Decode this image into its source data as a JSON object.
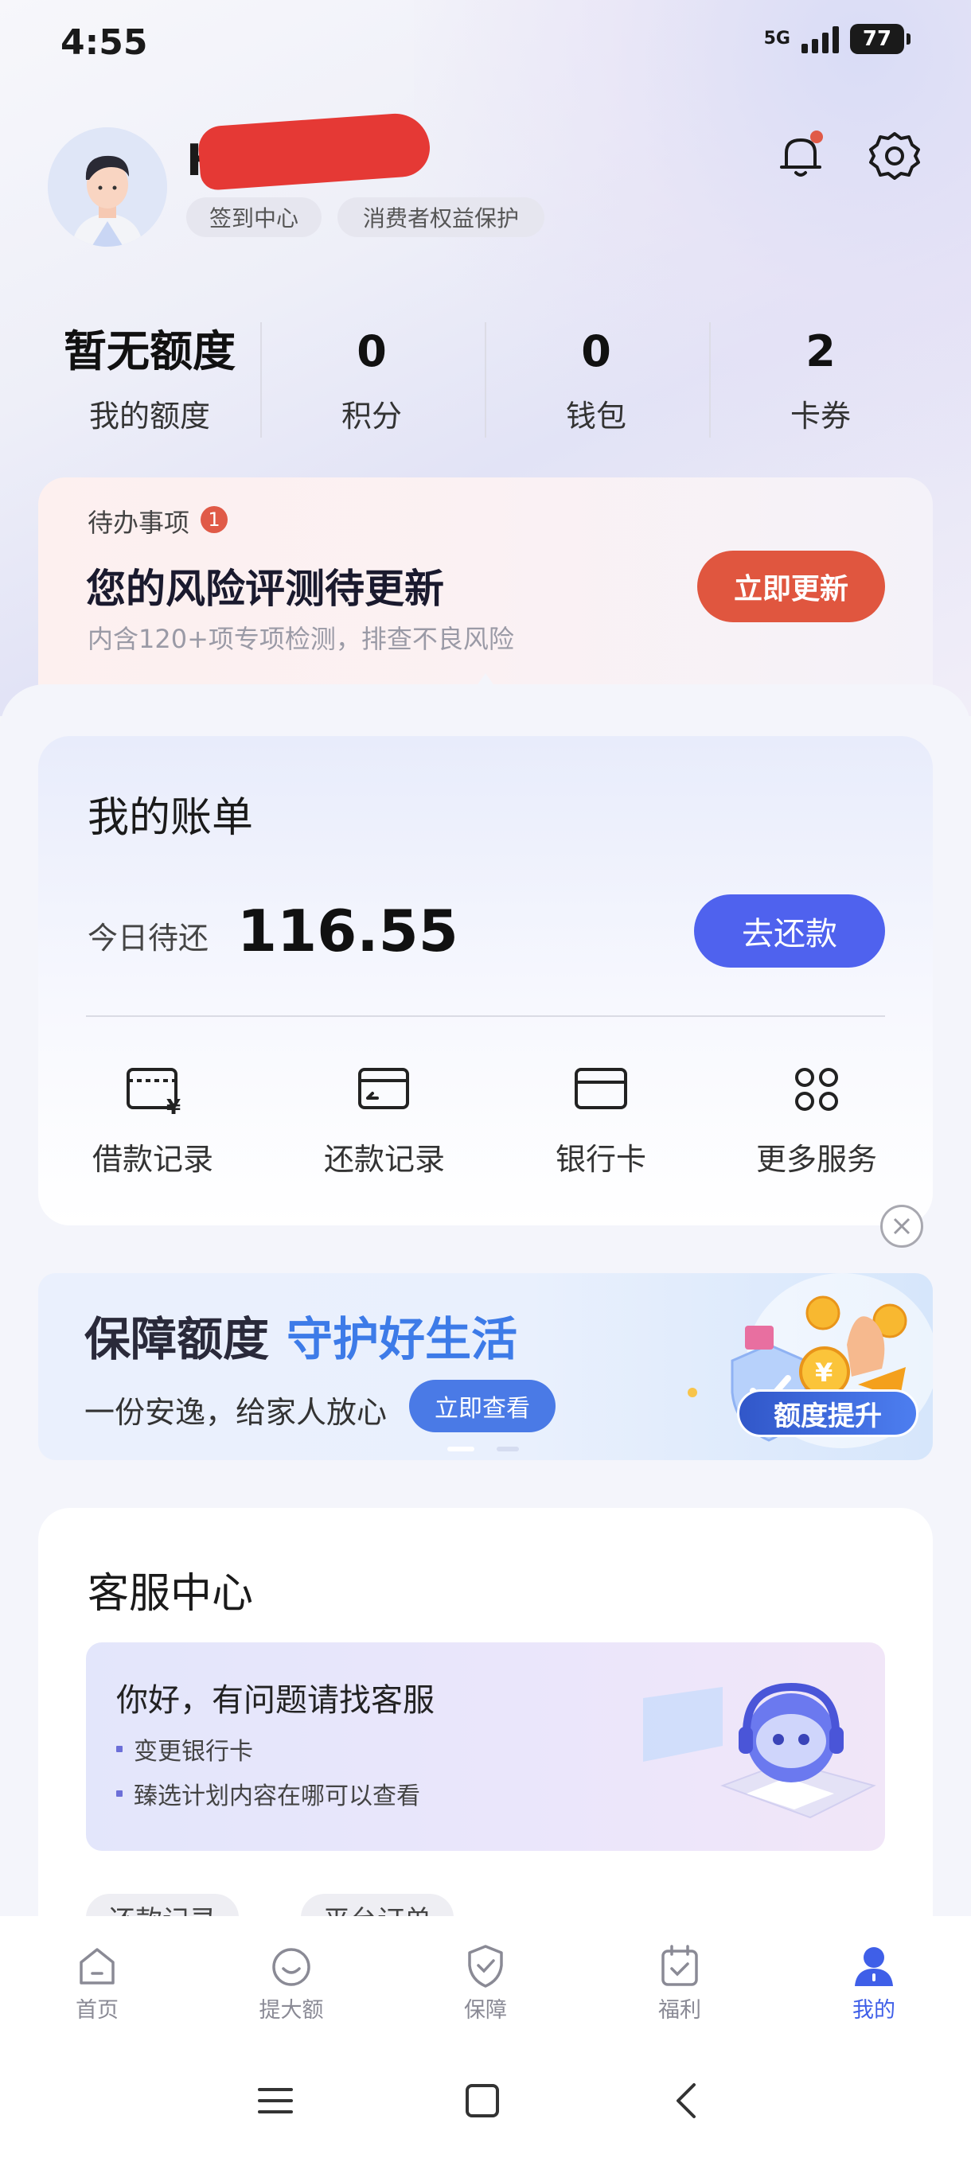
{
  "status": {
    "time": "4:55",
    "network": "5G",
    "battery": "77"
  },
  "header": {
    "greeting": "Hi",
    "pills": [
      "签到中心",
      "消费者权益保护"
    ]
  },
  "stats": [
    {
      "value": "暂无额度",
      "label": "我的额度"
    },
    {
      "value": "0",
      "label": "积分"
    },
    {
      "value": "0",
      "label": "钱包"
    },
    {
      "value": "2",
      "label": "卡券"
    }
  ],
  "todo": {
    "label": "待办事项",
    "badge": "1",
    "title": "您的风险评测待更新",
    "subtitle": "内含120+项专项检测，排查不良风险",
    "button": "立即更新"
  },
  "bill": {
    "title": "我的账单",
    "due_label": "今日待还",
    "amount": "116.55",
    "button": "去还款",
    "services": [
      "借款记录",
      "还款记录",
      "银行卡",
      "更多服务"
    ]
  },
  "banner": {
    "title_part1": "保障额度",
    "title_part2": "守护好生活",
    "subtitle": "一份安逸，给家人放心",
    "button": "立即查看",
    "tag": "额度提升"
  },
  "customer_service": {
    "title": "客服中心",
    "hello": "你好，有问题请找客服",
    "items": [
      "变更银行卡",
      "臻选计划内容在哪可以查看"
    ],
    "chips": [
      "还款记录",
      "平台订单"
    ]
  },
  "nav": {
    "items": [
      "首页",
      "提大额",
      "保障",
      "福利",
      "我的"
    ],
    "active": "我的"
  },
  "colors": {
    "accent": "#4f62ee",
    "alert": "#e0563f",
    "nav_active": "#3f5fe8"
  }
}
